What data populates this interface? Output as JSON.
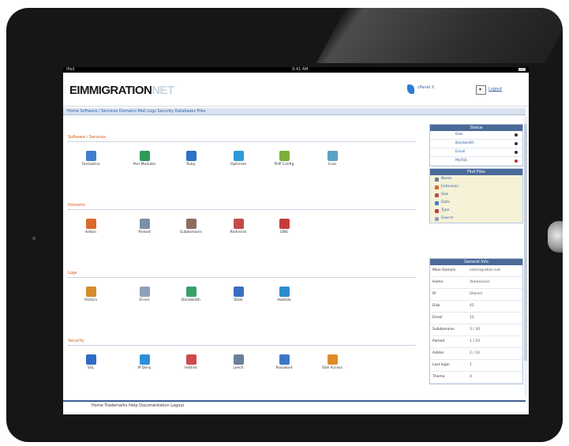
{
  "statusbar": {
    "carrier": "iPad",
    "time": "9:41 AM"
  },
  "app": {
    "logo_main": "EIMMIGRATION",
    "logo_suffix": "NET",
    "cpanel_text": "cPanel X",
    "logout": "Logout"
  },
  "nav": {
    "links": "Home  Software / Services  Domains  Mail  Logs  Security  Databases  Files"
  },
  "sections": [
    {
      "title": "Software / Services",
      "icons": [
        {
          "label": "Fantastico",
          "color": "#3f7fd0"
        },
        {
          "label": "Perl Modules",
          "color": "#2e9b57"
        },
        {
          "label": "Ruby",
          "color": "#2c72c7"
        },
        {
          "label": "Optimize",
          "color": "#2c9bd6"
        },
        {
          "label": "PHP Config",
          "color": "#7bb03a"
        },
        {
          "label": "Cron",
          "color": "#5aa3c8"
        }
      ]
    },
    {
      "title": "Domains",
      "icons": [
        {
          "label": "Addon",
          "color": "#d9692a"
        },
        {
          "label": "Parked",
          "color": "#7b8fa6"
        },
        {
          "label": "Subdomains",
          "color": "#8c6e5e"
        },
        {
          "label": "Redirects",
          "color": "#c44a4a"
        },
        {
          "label": "DNS",
          "color": "#c53b3b"
        }
      ]
    },
    {
      "title": "Logs",
      "icons": [
        {
          "label": "Visitors",
          "color": "#d58b2a"
        },
        {
          "label": "Errors",
          "color": "#8ea1b8"
        },
        {
          "label": "Bandwidth",
          "color": "#3aa06b"
        },
        {
          "label": "Stats",
          "color": "#3b6ec2"
        },
        {
          "label": "Awstats",
          "color": "#2b8bd0"
        }
      ]
    },
    {
      "title": "Security",
      "icons": [
        {
          "label": "SSL",
          "color": "#2e6bc6"
        },
        {
          "label": "IP Deny",
          "color": "#2f8fd9"
        },
        {
          "label": "Hotlink",
          "color": "#cf4a4a"
        },
        {
          "label": "Leech",
          "color": "#6c7f99"
        },
        {
          "label": "Password",
          "color": "#3b77c9"
        },
        {
          "label": "SSH Access",
          "color": "#e08a2a"
        }
      ]
    }
  ],
  "sidebar": {
    "panel1": {
      "title": "Status",
      "rows": [
        {
          "label": "Disk",
          "status": "ok"
        },
        {
          "label": "Bandwidth",
          "status": "ok"
        },
        {
          "label": "Email",
          "status": "ok"
        },
        {
          "label": "MySQL",
          "status": "warn"
        }
      ]
    },
    "panel2": {
      "title": "Find Files",
      "rows": [
        {
          "label": "Name",
          "color": "#6a7d98"
        },
        {
          "label": "Extension",
          "color": "#d9692a"
        },
        {
          "label": "Size",
          "color": "#c44a4a"
        },
        {
          "label": "Date",
          "color": "#3f7fd0"
        },
        {
          "label": "Type",
          "color": "#c53b3b"
        },
        {
          "label": "Search",
          "color": "#8ea1b8"
        }
      ]
    },
    "panel3": {
      "title": "General Info",
      "rows": [
        {
          "key": "Main Domain",
          "value": "eimmigration.net"
        },
        {
          "key": "Home",
          "value": "/home/user"
        },
        {
          "key": "IP",
          "value": "Shared"
        },
        {
          "key": "Disk",
          "value": "45"
        },
        {
          "key": "Email",
          "value": "12"
        },
        {
          "key": "Subdomains",
          "value": "3 / 30"
        },
        {
          "key": "Parked",
          "value": "1 / 10"
        },
        {
          "key": "Addon",
          "value": "2 / 10"
        },
        {
          "key": "Last login",
          "value": "1"
        },
        {
          "key": "Theme",
          "value": "X"
        }
      ]
    }
  },
  "footer": {
    "text": "Home  Trademarks  Help  Documentation  Logout"
  }
}
